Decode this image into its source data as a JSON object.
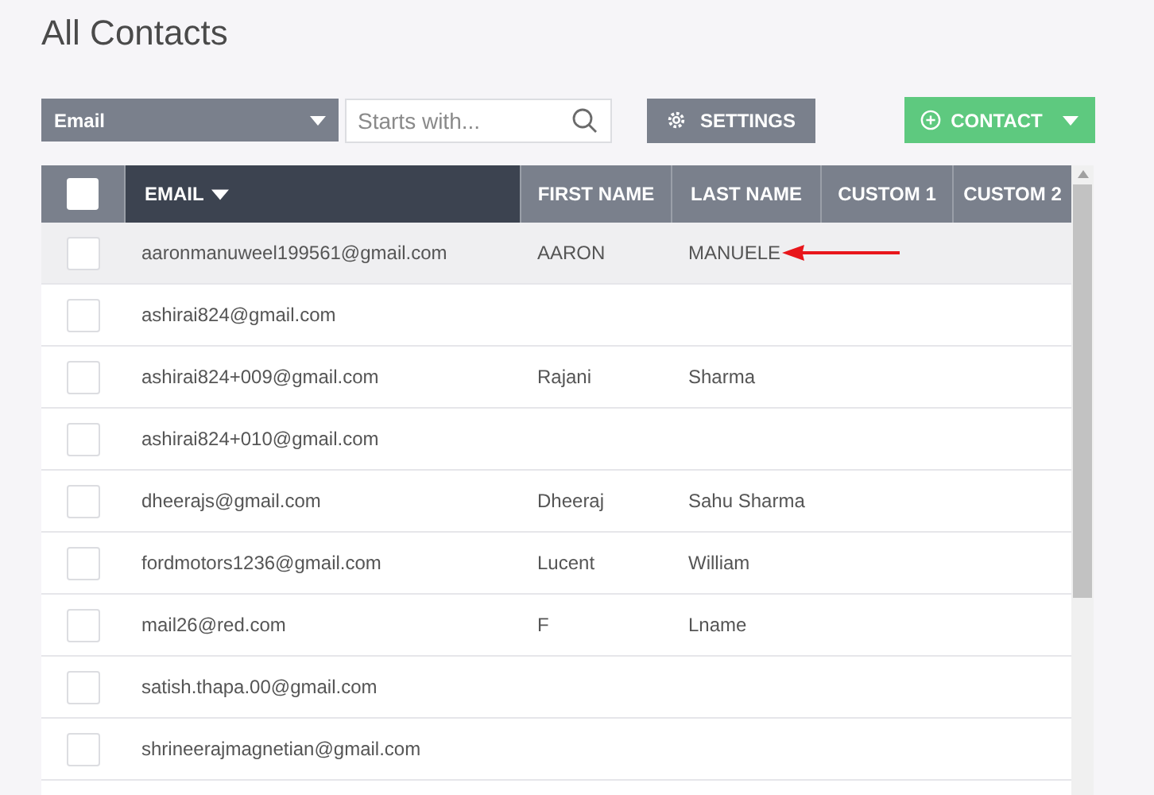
{
  "page_title": "All Contacts",
  "toolbar": {
    "filter_field": {
      "value": "Email"
    },
    "search": {
      "placeholder": "Starts with..."
    },
    "settings_button": {
      "label": "SETTINGS"
    },
    "contact_button": {
      "label": "CONTACT"
    }
  },
  "table": {
    "select_all": {
      "checked": false
    },
    "columns": [
      {
        "label": "EMAIL",
        "sorted": true
      },
      {
        "label": "FIRST NAME",
        "sorted": false
      },
      {
        "label": "LAST NAME",
        "sorted": false
      },
      {
        "label": "CUSTOM 1",
        "sorted": false
      },
      {
        "label": "CUSTOM 2",
        "sorted": false
      }
    ],
    "rows": [
      {
        "email": "aaronmanuweel199561@gmail.com",
        "first_name": "AARON",
        "last_name": "MANUELE",
        "checked": false,
        "highlighted": true,
        "annotated": true
      },
      {
        "email": "ashirai824@gmail.com",
        "first_name": "",
        "last_name": "",
        "checked": false,
        "highlighted": false,
        "annotated": false
      },
      {
        "email": "ashirai824+009@gmail.com",
        "first_name": "Rajani",
        "last_name": "Sharma",
        "checked": false,
        "highlighted": false,
        "annotated": false
      },
      {
        "email": "ashirai824+010@gmail.com",
        "first_name": "",
        "last_name": "",
        "checked": false,
        "highlighted": false,
        "annotated": false
      },
      {
        "email": "dheerajs@gmail.com",
        "first_name": "Dheeraj",
        "last_name": "Sahu Sharma",
        "checked": false,
        "highlighted": false,
        "annotated": false
      },
      {
        "email": "fordmotors1236@gmail.com",
        "first_name": "Lucent",
        "last_name": "William",
        "checked": false,
        "highlighted": false,
        "annotated": false
      },
      {
        "email": "mail26@red.com",
        "first_name": "F",
        "last_name": "Lname",
        "checked": false,
        "highlighted": false,
        "annotated": false
      },
      {
        "email": "satish.thapa.00@gmail.com",
        "first_name": "",
        "last_name": "",
        "checked": false,
        "highlighted": false,
        "annotated": false
      },
      {
        "email": "shrineerajmagnetian@gmail.com",
        "first_name": "",
        "last_name": "",
        "checked": false,
        "highlighted": false,
        "annotated": false
      }
    ]
  }
}
